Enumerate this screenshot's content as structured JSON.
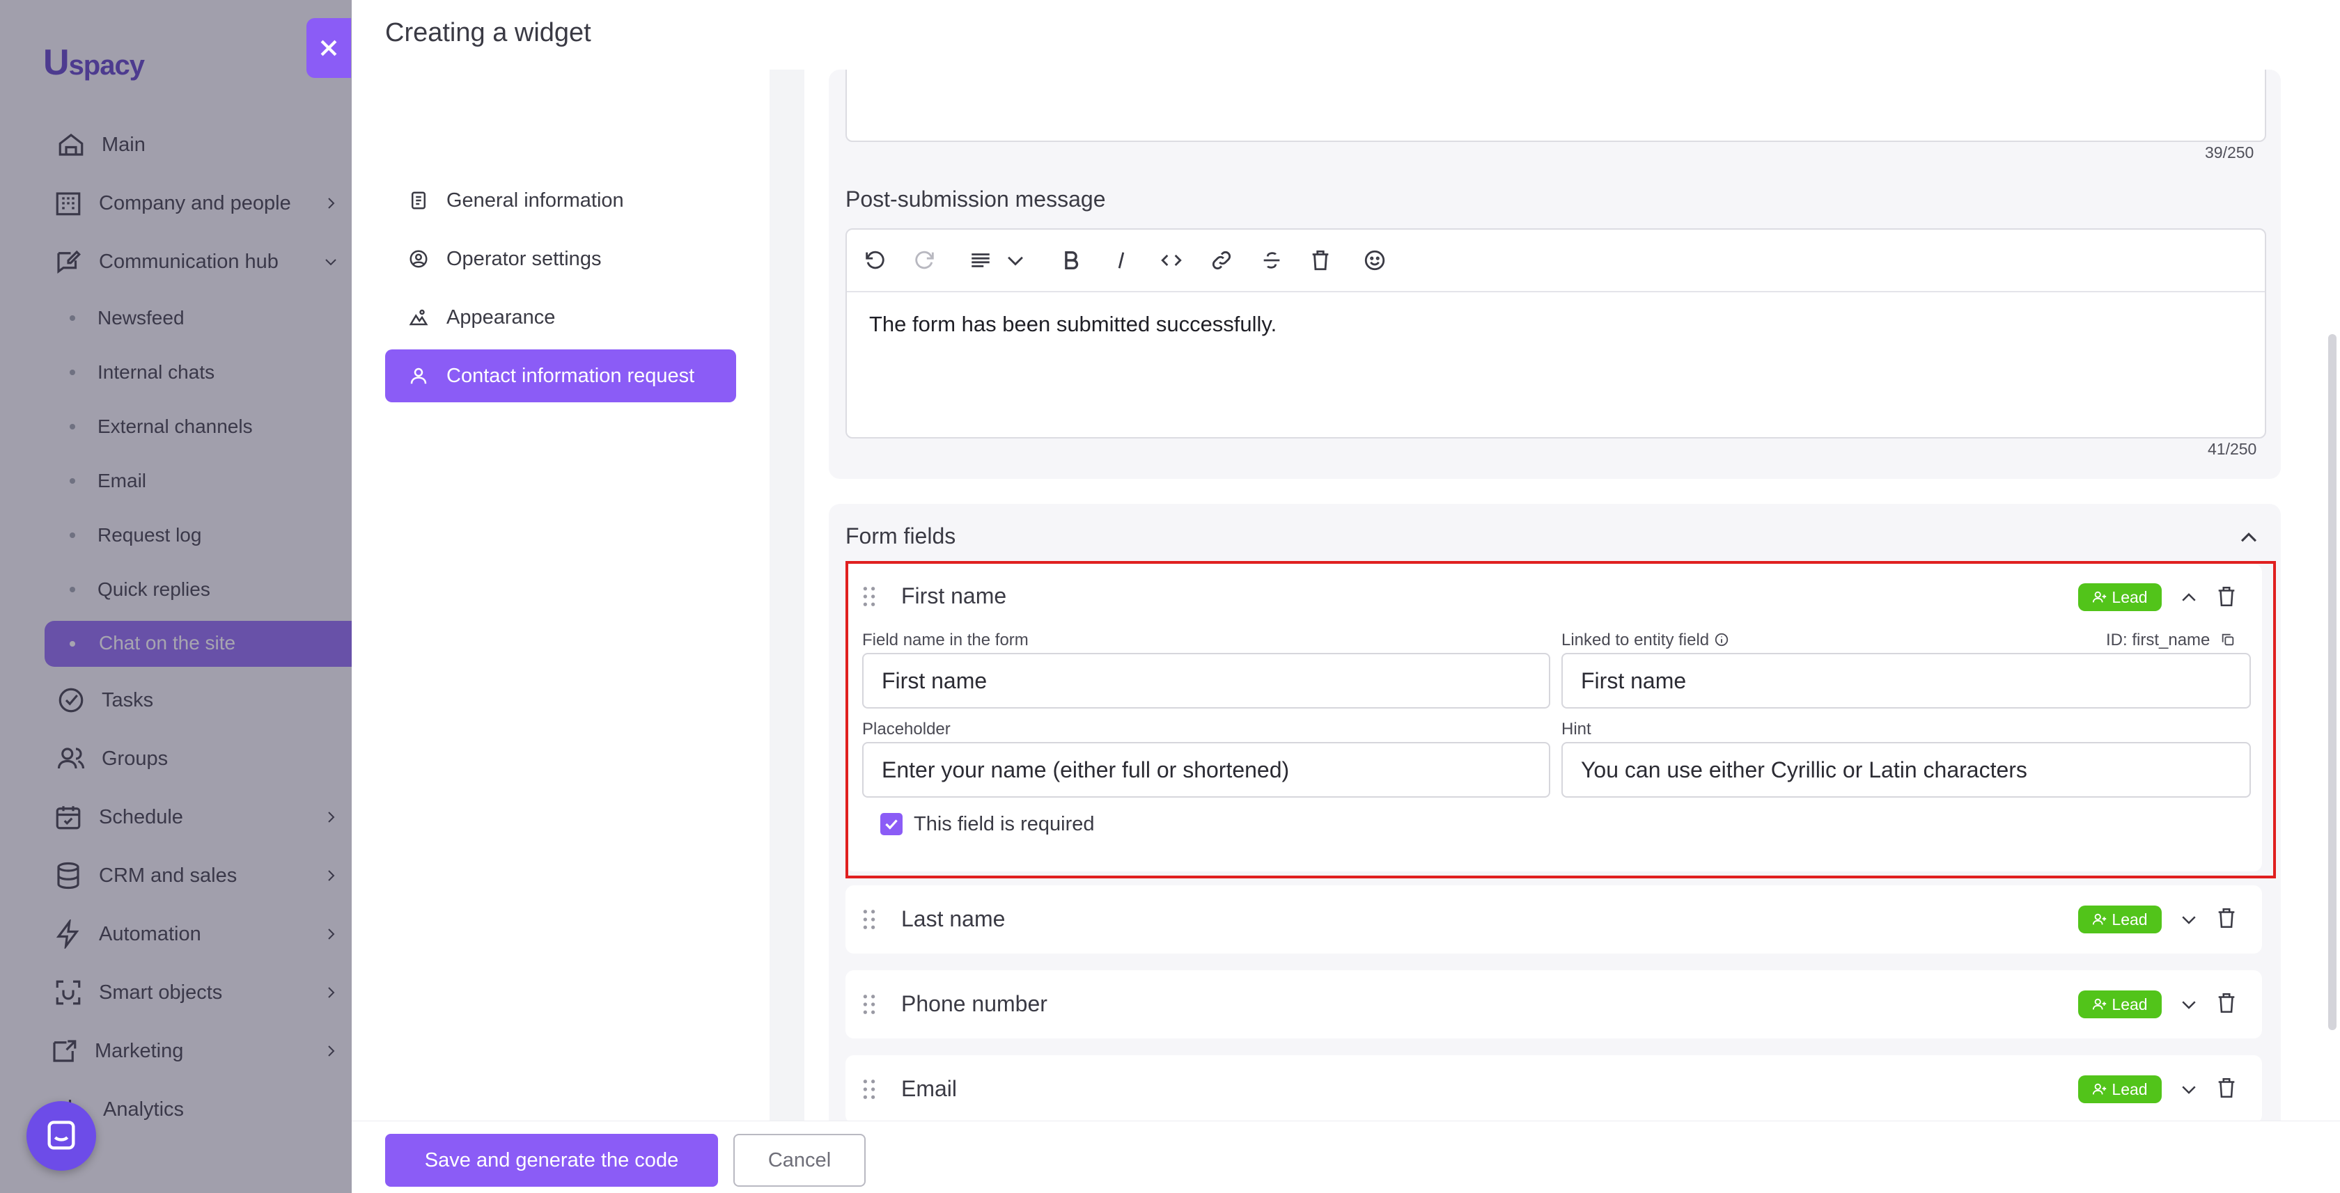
{
  "app": {
    "logo": "spacy",
    "logo_mark": "U",
    "nav": [
      {
        "label": "Main",
        "icon": "home-icon"
      },
      {
        "label": "Company and people",
        "icon": "building-icon"
      },
      {
        "label": "Communication hub",
        "icon": "chat-edit-icon"
      },
      {
        "label": "Tasks",
        "icon": "check-circle-icon"
      },
      {
        "label": "Groups",
        "icon": "users-icon"
      },
      {
        "label": "Schedule",
        "icon": "calendar-icon"
      },
      {
        "label": "CRM and sales",
        "icon": "database-icon"
      },
      {
        "label": "Automation",
        "icon": "lightning-icon"
      },
      {
        "label": "Smart objects",
        "icon": "scan-icon"
      },
      {
        "label": "Marketing",
        "icon": "megaphone-icon"
      },
      {
        "label": "Analytics",
        "icon": "chart-icon"
      }
    ],
    "sub_nav": [
      "Newsfeed",
      "Internal chats",
      "External channels",
      "Email",
      "Request log",
      "Quick replies",
      "Chat on the site"
    ]
  },
  "panel": {
    "title": "Creating a widget",
    "sidebar": [
      {
        "label": "General information",
        "icon": "document-icon"
      },
      {
        "label": "Operator settings",
        "icon": "user-circle-icon"
      },
      {
        "label": "Appearance",
        "icon": "paint-icon"
      },
      {
        "label": "Contact information request",
        "icon": "user-icon"
      }
    ]
  },
  "messages": {
    "top_counter": "39/250",
    "post_label": "Post-submission message",
    "post_text": "The form has been submitted successfully.",
    "post_counter": "41/250"
  },
  "form_fields": {
    "title": "Form fields",
    "badge_label": "Lead",
    "expanded": {
      "title": "First name",
      "field_name_label": "Field name in the form",
      "field_name_value": "First name",
      "linked_label": "Linked to entity field",
      "id_label": "ID: first_name",
      "linked_value": "First name",
      "placeholder_label": "Placeholder",
      "placeholder_value": "Enter your name (either full or shortened)",
      "hint_label": "Hint",
      "hint_value": "You can use either Cyrillic or Latin characters",
      "required_label": "This field is required",
      "required_checked": true
    },
    "collapsed": [
      "Last name",
      "Phone number",
      "Email"
    ]
  },
  "footer": {
    "save_label": "Save and generate the code",
    "cancel_label": "Cancel"
  },
  "colors": {
    "accent": "#8b5cf6",
    "lead": "#52c41a",
    "highlight": "#e02020"
  }
}
